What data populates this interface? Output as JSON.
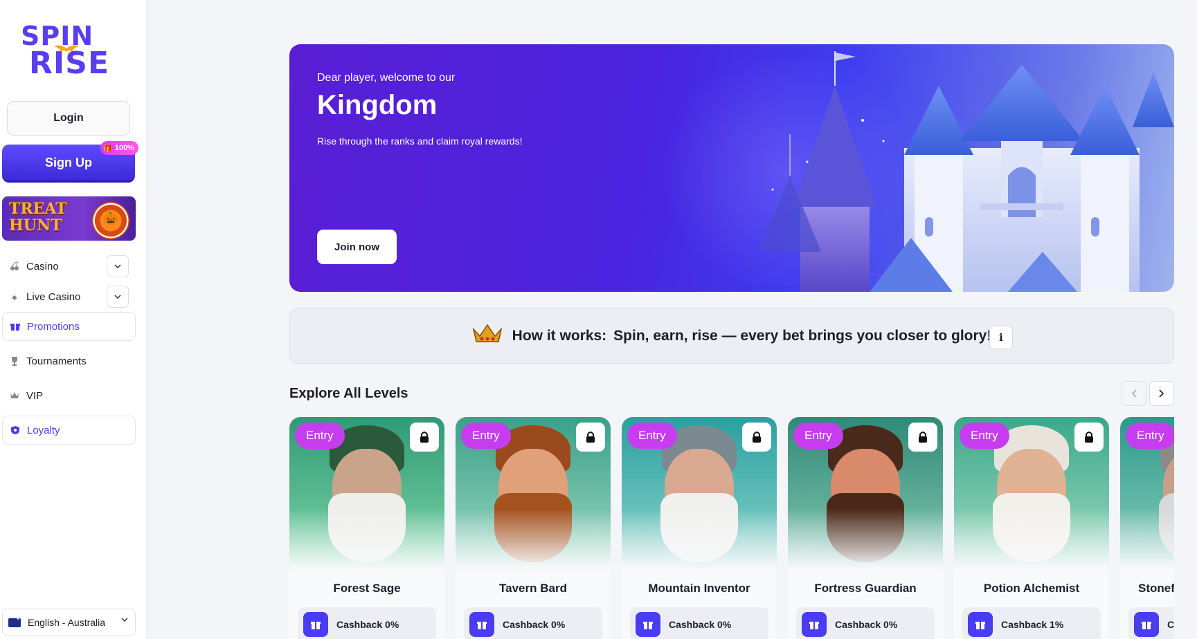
{
  "brand": {
    "line1": "SPIN",
    "line2": "RISE"
  },
  "auth": {
    "login_label": "Login",
    "signup_label": "Sign Up",
    "signup_badge": "100%"
  },
  "promo_banner": {
    "line1": "TREAT",
    "line2": "HUNT"
  },
  "nav": {
    "casino": "Casino",
    "live_casino": "Live Casino",
    "promotions": "Promotions",
    "tournaments": "Tournaments",
    "vip": "VIP",
    "loyalty": "Loyalty"
  },
  "language": {
    "selected": "English - Australia"
  },
  "hero": {
    "welcome": "Dear player, welcome to our",
    "title": "Kingdom",
    "subtitle": "Rise through the ranks and claim royal rewards!",
    "cta": "Join now"
  },
  "how_it_works": {
    "label": "How it works:",
    "text": "Spin, earn, rise — every bet brings you closer to glory!",
    "info": "i"
  },
  "levels": {
    "title": "Explore All Levels",
    "items": [
      {
        "badge": "Entry",
        "name": "Forest Sage",
        "cashback": "Cashback 0%"
      },
      {
        "badge": "Entry",
        "name": "Tavern Bard",
        "cashback": "Cashback 0%"
      },
      {
        "badge": "Entry",
        "name": "Mountain Inventor",
        "cashback": "Cashback 0%"
      },
      {
        "badge": "Entry",
        "name": "Fortress Guardian",
        "cashback": "Cashback 0%"
      },
      {
        "badge": "Entry",
        "name": "Potion Alchemist",
        "cashback": "Cashback 1%"
      },
      {
        "badge": "Entry",
        "name": "Stonef",
        "cashback": "C"
      }
    ]
  },
  "colors": {
    "accent": "#4a3cf0",
    "entry_badge": "#c63df0"
  }
}
